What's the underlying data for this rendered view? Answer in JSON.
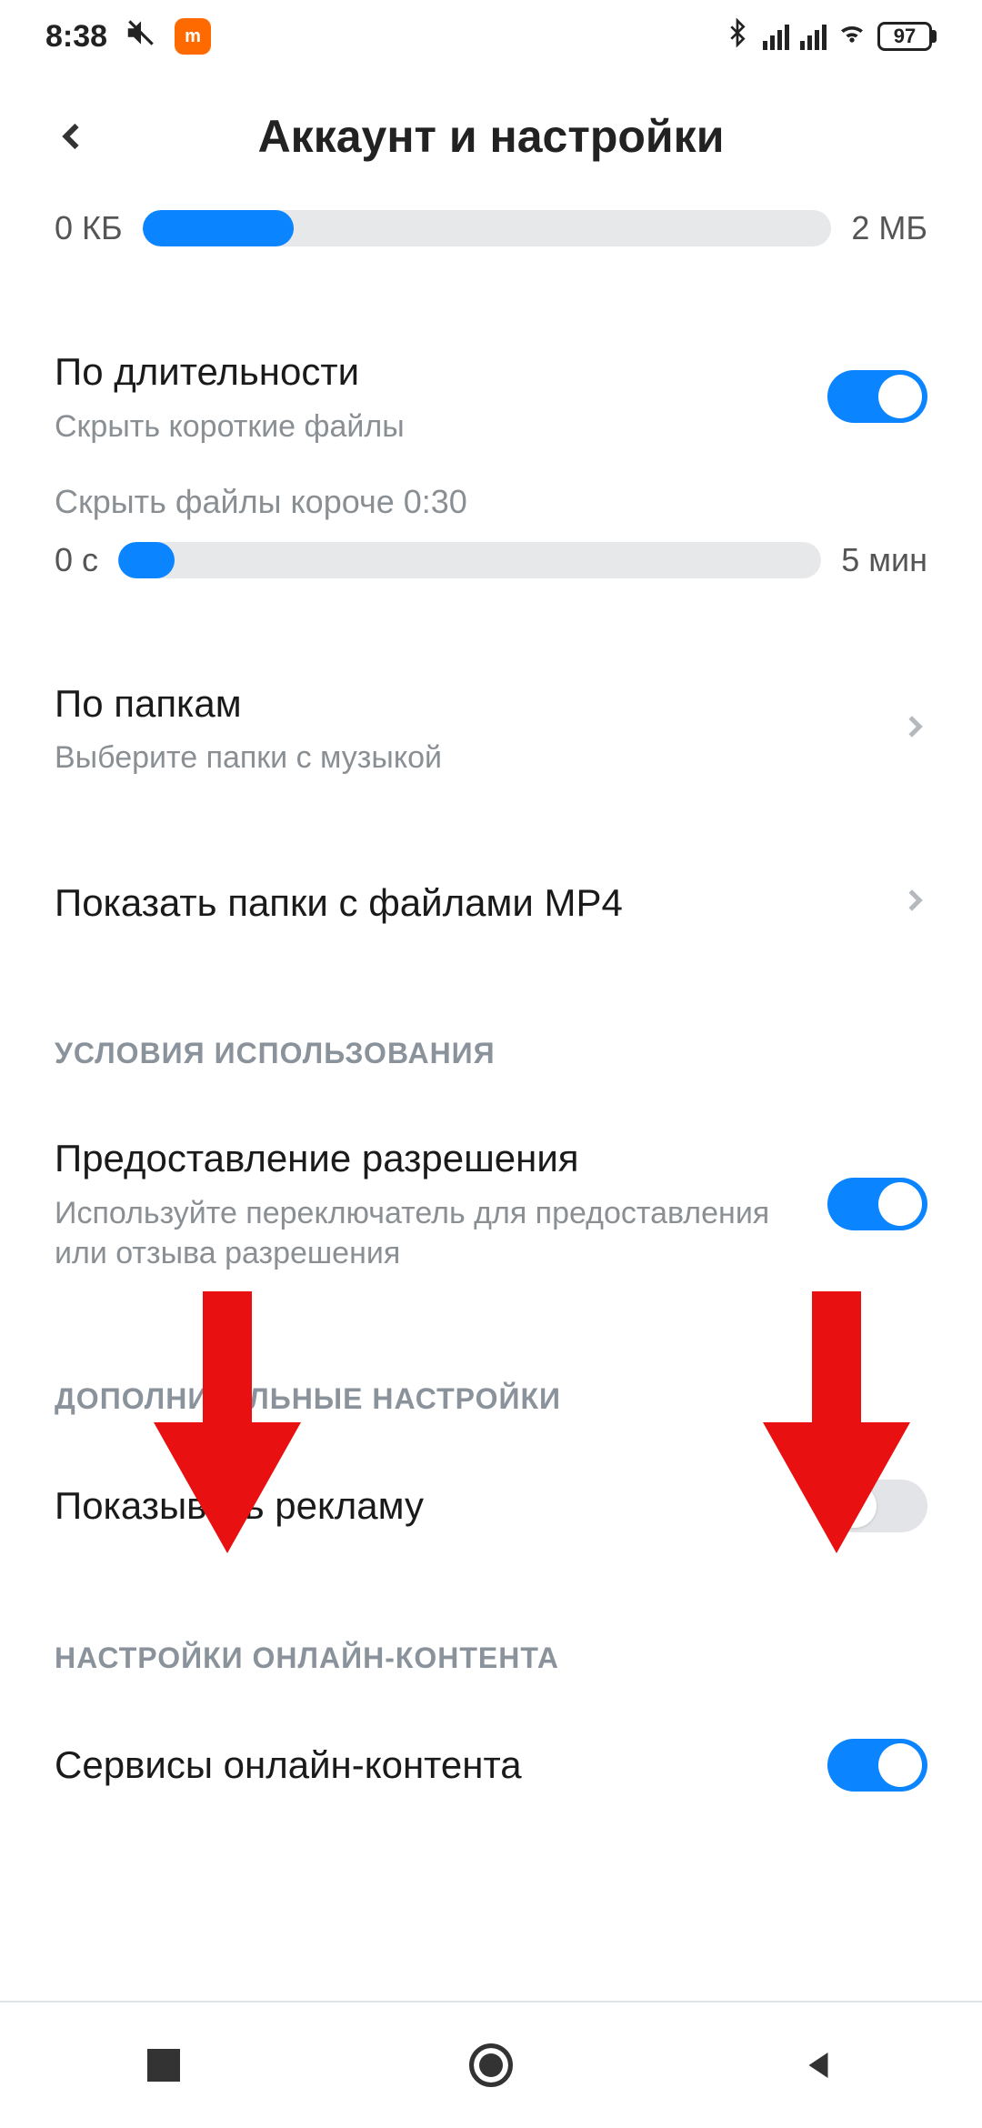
{
  "status": {
    "time": "8:38",
    "battery_pct": "97"
  },
  "header": {
    "title": "Аккаунт и настройки"
  },
  "size_slider": {
    "min_label": "0 КБ",
    "max_label": "2 МБ"
  },
  "duration": {
    "title": "По длительности",
    "subtitle": "Скрыть короткие файлы",
    "hide_note": "Скрыть файлы короче 0:30",
    "min_label": "0 с",
    "max_label": "5 мин",
    "toggle_on": true
  },
  "folders": {
    "title": "По папкам",
    "subtitle": "Выберите папки с музыкой"
  },
  "mp4": {
    "title": "Показать папки с файлами MP4"
  },
  "sections": {
    "terms": "УСЛОВИЯ ИСПОЛЬЗОВАНИЯ",
    "extra": "ДОПОЛНИТЕЛЬНЫЕ НАСТРОЙКИ",
    "online": "НАСТРОЙКИ ОНЛАЙН-КОНТЕНТА"
  },
  "permission": {
    "title": "Предоставление разрешения",
    "subtitle": "Используйте переключатель для предоставления или отзыва разрешения",
    "toggle_on": true
  },
  "ads": {
    "title": "Показывать рекламу",
    "toggle_on": false
  },
  "online_services": {
    "title": "Сервисы онлайн-контента",
    "toggle_on": true
  }
}
